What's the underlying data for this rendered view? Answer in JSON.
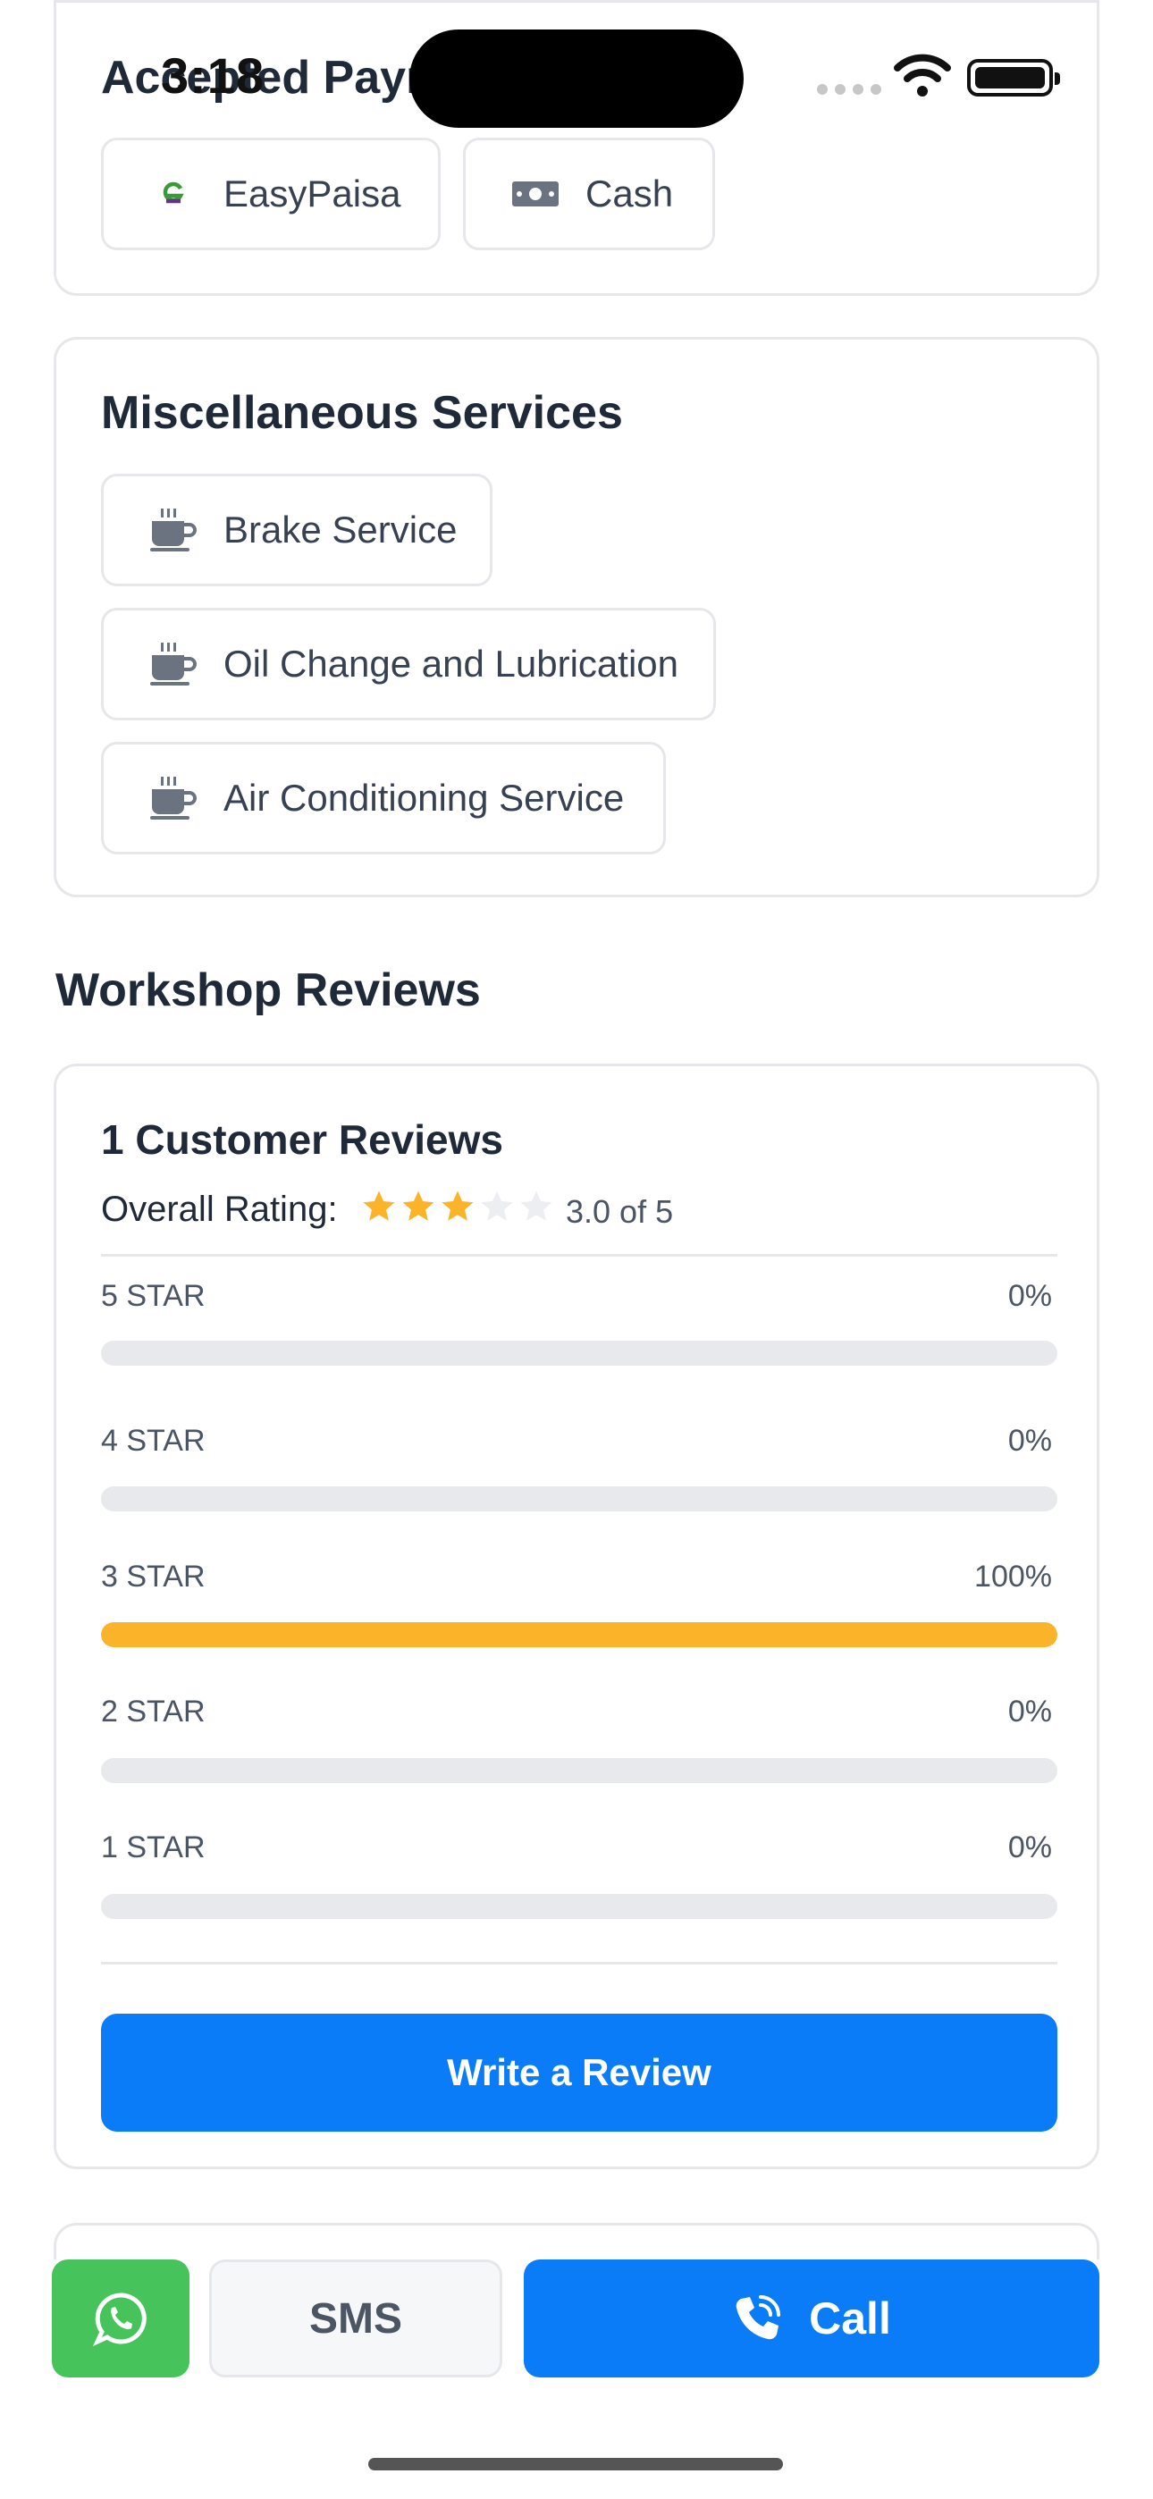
{
  "status_bar": {
    "time": "3:18"
  },
  "payments": {
    "title": "Accepted Payments",
    "methods": [
      {
        "label": "EasyPaisa",
        "icon": "easypaisa-logo-icon"
      },
      {
        "label": "Cash",
        "icon": "banknote-icon"
      }
    ]
  },
  "misc_services": {
    "title": "Miscellaneous Services",
    "items": [
      {
        "label": "Brake Service",
        "icon": "coffee-cup-icon"
      },
      {
        "label": "Oil Change and Lubrication",
        "icon": "coffee-cup-icon"
      },
      {
        "label": "Air Conditioning Service",
        "icon": "coffee-cup-icon"
      }
    ]
  },
  "reviews": {
    "section_title": "Workshop Reviews",
    "summary_title": "1 Customer Reviews",
    "overall_label": "Overall Rating:",
    "rating_value": 3,
    "rating_max": 5,
    "rating_text": "3.0 of 5",
    "breakdown": [
      {
        "label": "5 STAR",
        "percent_text": "0%",
        "percent": 0
      },
      {
        "label": "4 STAR",
        "percent_text": "0%",
        "percent": 0
      },
      {
        "label": "3 STAR",
        "percent_text": "100%",
        "percent": 100
      },
      {
        "label": "2 STAR",
        "percent_text": "0%",
        "percent": 0
      },
      {
        "label": "1 STAR",
        "percent_text": "0%",
        "percent": 0
      }
    ],
    "write_button": "Write a Review"
  },
  "actions": {
    "whatsapp_icon": "whatsapp-icon",
    "sms_label": "SMS",
    "call_label": "Call"
  },
  "colors": {
    "primary": "#0a7cf7",
    "whatsapp": "#46c35a",
    "star": "#fbb32a",
    "star_empty": "#eceef1"
  }
}
